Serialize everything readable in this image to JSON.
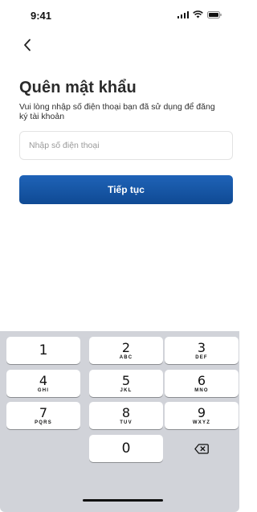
{
  "status_bar": {
    "time": "9:41"
  },
  "header": {
    "back_icon": "chevron-left-icon"
  },
  "page": {
    "title": "Quên mật khẩu",
    "description": "Vui lòng nhập số điện thoại bạn đã sử dụng để đăng ký tài khoản"
  },
  "phone_field": {
    "placeholder": "Nhập số điện thoại",
    "value": ""
  },
  "continue_button": {
    "label": "Tiếp tục",
    "color": "#1657a7"
  },
  "keypad": {
    "keys": [
      {
        "num": "1",
        "letters": ""
      },
      {
        "num": "2",
        "letters": "ABC"
      },
      {
        "num": "3",
        "letters": "DEF"
      },
      {
        "num": "4",
        "letters": "GHI"
      },
      {
        "num": "5",
        "letters": "JKL"
      },
      {
        "num": "6",
        "letters": "MNO"
      },
      {
        "num": "7",
        "letters": "PQRS"
      },
      {
        "num": "8",
        "letters": "TUV"
      },
      {
        "num": "9",
        "letters": "WXYZ"
      },
      {
        "num": "0",
        "letters": ""
      }
    ],
    "delete_icon": "backspace-icon"
  }
}
